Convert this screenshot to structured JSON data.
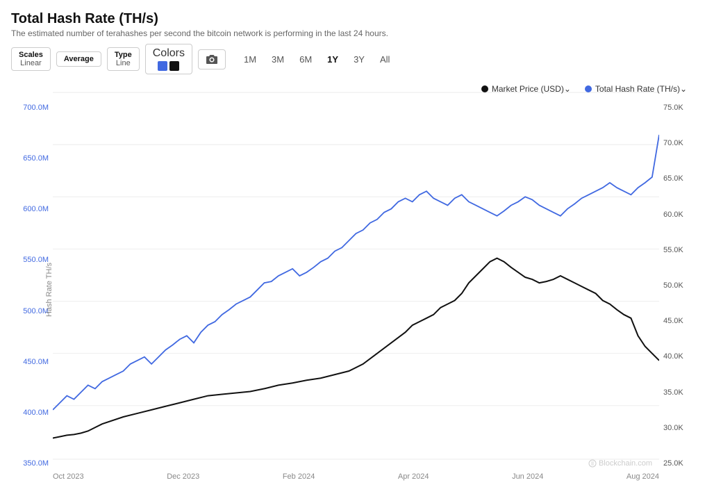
{
  "page": {
    "title": "Total Hash Rate (TH/s)",
    "subtitle": "The estimated number of terahashes per second the bitcoin network is performing in the last 24 hours.",
    "controls": {
      "scales_label": "Scales",
      "scales_value": "Linear",
      "average_label": "Average",
      "type_label": "Type",
      "type_value": "Line",
      "colors_label": "Colors"
    },
    "time_ranges": [
      "1M",
      "3M",
      "6M",
      "1Y",
      "3Y",
      "All"
    ],
    "active_range": "1Y",
    "legend": [
      {
        "label": "Market Price (USD)",
        "color": "black"
      },
      {
        "label": "Total Hash Rate (TH/s)",
        "color": "blue"
      }
    ],
    "left_axis_label": "Hash Rate TH/s",
    "left_axis_values": [
      "700.0M",
      "650.0M",
      "600.0M",
      "550.0M",
      "500.0M",
      "450.0M",
      "400.0M",
      "350.0M"
    ],
    "right_axis_values": [
      "75.0K",
      "70.0K",
      "65.0K",
      "60.0K",
      "55.0K",
      "50.0K",
      "45.0K",
      "40.0K",
      "35.0K",
      "30.0K",
      "25.0K"
    ],
    "x_axis_labels": [
      "Oct 2023",
      "Dec 2023",
      "Feb 2024",
      "Apr 2024",
      "Jun 2024",
      "Aug 2024"
    ],
    "watermark": "Blockchain.com"
  }
}
